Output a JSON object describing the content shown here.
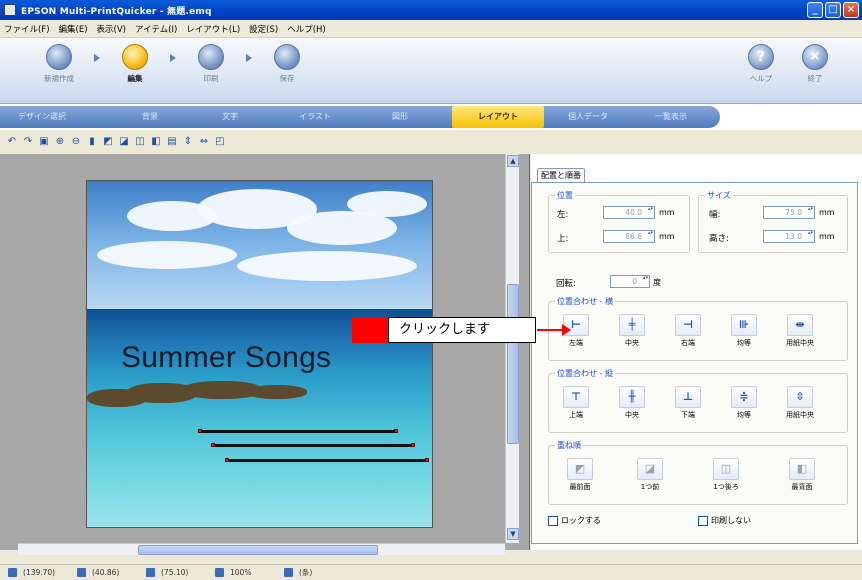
{
  "window": {
    "title": "EPSON Multi-PrintQuicker - 無題.emq"
  },
  "menu": [
    "ファイル(F)",
    "編集(E)",
    "表示(V)",
    "アイテム(I)",
    "レイアウト(L)",
    "設定(S)",
    "ヘルプ(H)"
  ],
  "steps": [
    {
      "label": "新規作成"
    },
    {
      "label": "編集"
    },
    {
      "label": "印刷"
    },
    {
      "label": "保存"
    }
  ],
  "help_buttons": {
    "help": "ヘルプ",
    "quit": "終了",
    "help_glyph": "?",
    "quit_glyph": "×"
  },
  "tabs": [
    "デザイン選択",
    "背景",
    "文字",
    "イラスト",
    "図形",
    "レイアウト",
    "個人データ",
    "一覧表示"
  ],
  "active_tab": "レイアウト",
  "canvas": {
    "title_text": "Summer Songs"
  },
  "panel": {
    "tab": "配置と順番",
    "position": {
      "title": "位置",
      "left_label": "左:",
      "left_value": "40.0",
      "top_label": "上:",
      "top_value": "86.6",
      "unit": "mm"
    },
    "size": {
      "title": "サイズ",
      "width_label": "幅:",
      "width_value": "75.0",
      "height_label": "高さ:",
      "height_value": "13.0",
      "unit": "mm"
    },
    "rotation": {
      "label": "回転:",
      "value": "0",
      "unit": "度"
    },
    "align_h": {
      "title": "位置合わせ - 横",
      "buttons": [
        "左端",
        "中央",
        "右端",
        "均等",
        "用紙中央"
      ]
    },
    "align_v": {
      "title": "位置合わせ - 縦",
      "buttons": [
        "上端",
        "中央",
        "下端",
        "均等",
        "用紙中央"
      ]
    },
    "order": {
      "title": "重ね順",
      "buttons": [
        "最前面",
        "1つ前",
        "1つ後ろ",
        "最背面"
      ]
    },
    "lock_label": "ロックする",
    "noprint_label": "印刷しない"
  },
  "callout": {
    "text": "クリックします"
  },
  "status": [
    "(139.70)",
    "(40.86)",
    "(75.10)",
    "100%",
    "(条)"
  ]
}
